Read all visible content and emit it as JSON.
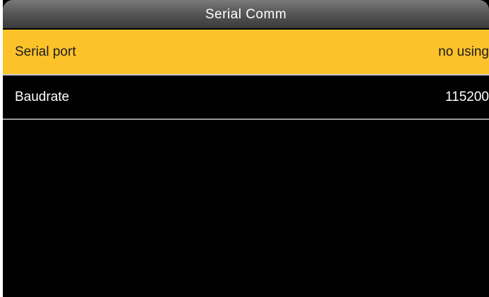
{
  "header": {
    "title": "Serial Comm"
  },
  "settings": [
    {
      "label": "Serial port",
      "value": "no using",
      "selected": true
    },
    {
      "label": "Baudrate",
      "value": "115200",
      "selected": false
    }
  ],
  "colors": {
    "selected_row": "#fcc22a",
    "background": "#000000",
    "title_bar": "#585858"
  }
}
